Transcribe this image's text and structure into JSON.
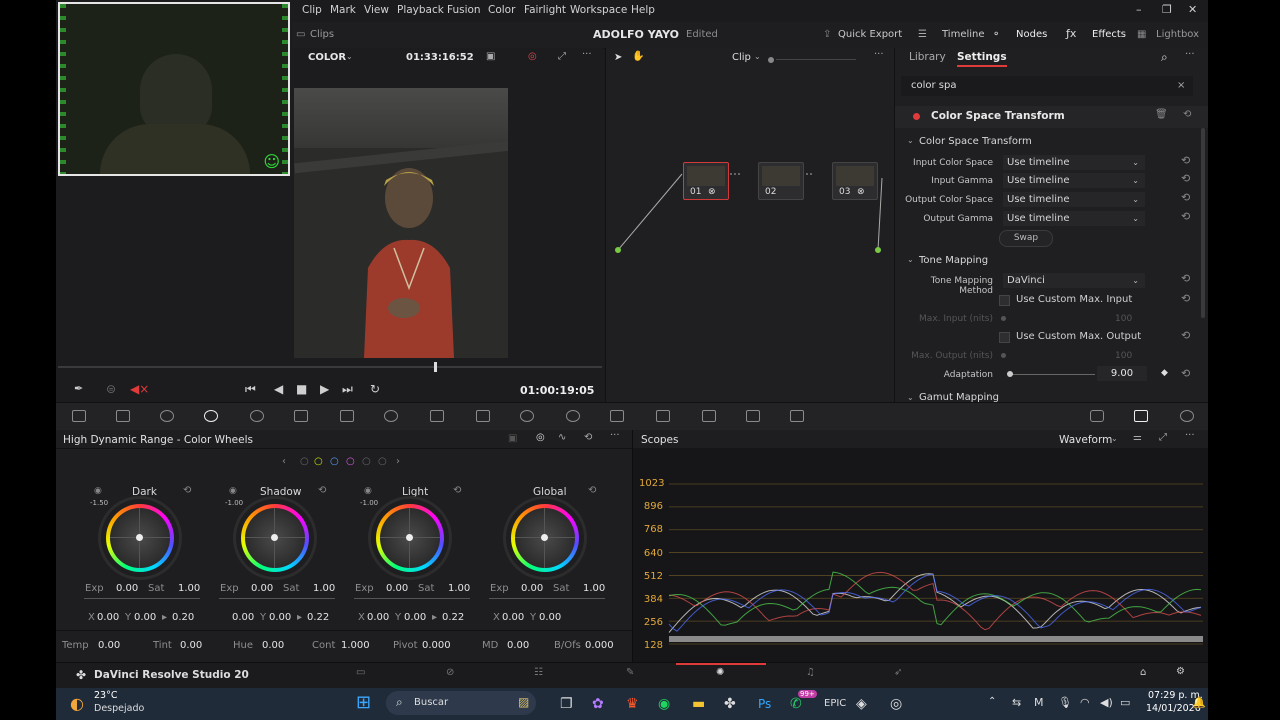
{
  "menu": {
    "items": [
      "Clip",
      "Mark",
      "View",
      "Playback",
      "Fusion",
      "Color",
      "Fairlight",
      "Workspace",
      "Help"
    ]
  },
  "window": {
    "minimize": "–",
    "maximize": "❐",
    "close": "✕"
  },
  "project_bar": {
    "clips_label": "Clips",
    "project_name": "ADOLFO YAYO",
    "project_status": "Edited",
    "quick_export": "Quick Export",
    "timeline": "Timeline",
    "nodes": "Nodes",
    "effects": "Effects",
    "lightbox": "Lightbox"
  },
  "viewer": {
    "page_mode": "COLOR",
    "source_timecode": "01:33:16:52",
    "clip_mode": "Clip",
    "playhead_timecode": "01:00:19:05"
  },
  "node_editor": {
    "nodes": [
      {
        "label": "01",
        "selected": true
      },
      {
        "label": "02",
        "selected": false
      },
      {
        "label": "03",
        "selected": false
      }
    ]
  },
  "right_panel": {
    "tab_library": "Library",
    "tab_settings": "Settings",
    "search_value": "color spa",
    "effect_title": "Color Space Transform",
    "section_cst": "Color Space Transform",
    "rows": [
      {
        "label": "Input Color Space",
        "value": "Use timeline"
      },
      {
        "label": "Input Gamma",
        "value": "Use timeline"
      },
      {
        "label": "Output Color Space",
        "value": "Use timeline"
      },
      {
        "label": "Output Gamma",
        "value": "Use timeline"
      }
    ],
    "swap": "Swap",
    "section_tone": "Tone Mapping",
    "tone_method_label": "Tone Mapping Method",
    "tone_method_value": "DaVinci",
    "use_custom_input": "Use Custom Max. Input",
    "max_input_label": "Max. Input (nits)",
    "max_input_value": "100",
    "use_custom_output": "Use Custom Max. Output",
    "max_output_label": "Max. Output (nits)",
    "max_output_value": "100",
    "adaptation_label": "Adaptation",
    "adaptation_value": "9.00",
    "section_gamut": "Gamut Mapping"
  },
  "wheels_panel": {
    "title": "High Dynamic Range - Color Wheels",
    "wheels": [
      {
        "name": "Dark",
        "zone": "-1.50",
        "exp": "0.00",
        "sat": "1.00",
        "x": "0.00",
        "y": "0.00",
        "w": "0.20"
      },
      {
        "name": "Shadow",
        "zone": "-1.00",
        "exp": "0.00",
        "sat": "1.00",
        "x": "0.00",
        "y": "0.00",
        "w": "0.22"
      },
      {
        "name": "Light",
        "zone": "-1.00",
        "exp": "0.00",
        "sat": "1.00",
        "x": "0.00",
        "y": "0.00",
        "w": "0.22"
      },
      {
        "name": "Global",
        "zone": "",
        "exp": "0.00",
        "sat": "1.00",
        "x": "0.00",
        "y": "0.00",
        "w": ""
      }
    ],
    "labels": {
      "exp": "Exp",
      "sat": "Sat",
      "x": "X",
      "y": "Y"
    },
    "bottom": [
      {
        "label": "Temp",
        "value": "0.00"
      },
      {
        "label": "Tint",
        "value": "0.00"
      },
      {
        "label": "Hue",
        "value": "0.00"
      },
      {
        "label": "Cont",
        "value": "1.000"
      },
      {
        "label": "Pivot",
        "value": "0.000"
      },
      {
        "label": "MD",
        "value": "0.00"
      },
      {
        "label": "B/Ofs",
        "value": "0.000"
      }
    ]
  },
  "scopes": {
    "title": "Scopes",
    "mode": "Waveform",
    "ticks": [
      "1023",
      "896",
      "768",
      "640",
      "512",
      "384",
      "256",
      "128"
    ]
  },
  "app_bar": {
    "name": "DaVinci Resolve Studio 20"
  },
  "taskbar": {
    "weather_temp": "23°C",
    "weather_desc": "Despejado",
    "search_placeholder": "Buscar",
    "notif_badge": "99+",
    "time": "07:29 p. m.",
    "date": "14/01/2026"
  },
  "colors": {
    "accent_red": "#e03b3b",
    "wave_yellow": "#e1a83a",
    "selected_node": "#d23a3a"
  }
}
